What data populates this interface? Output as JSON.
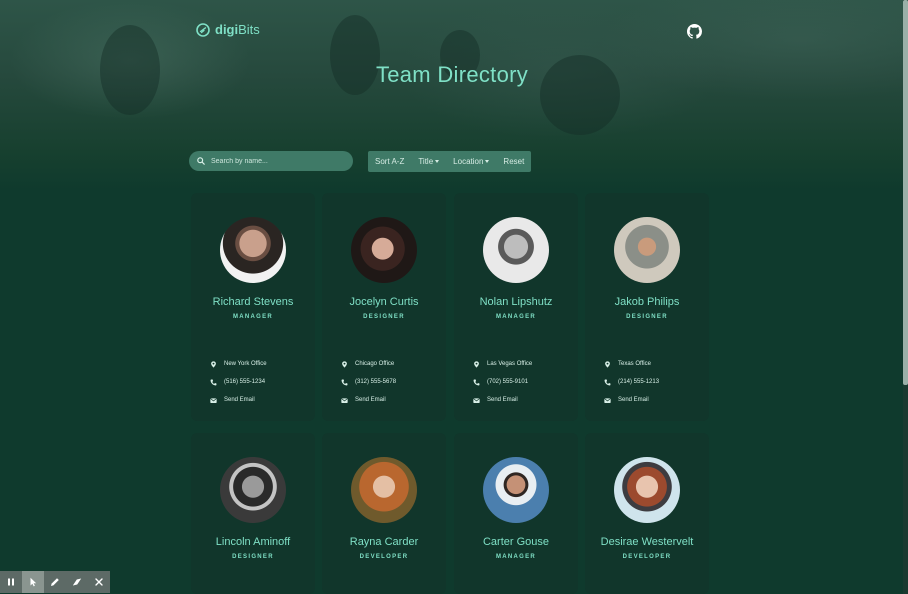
{
  "brand": {
    "prefix": "digi",
    "name": "Bits"
  },
  "page_title": "Team Directory",
  "search": {
    "placeholder": "Search by name..."
  },
  "toolbar": {
    "sort": "Sort A-Z",
    "title": "Title",
    "location": "Location",
    "reset": "Reset"
  },
  "people": [
    {
      "name": "Richard Stevens",
      "title": "MANAGER",
      "office": "New York Office",
      "phone": "(516) 555-1234",
      "email": "Send Email"
    },
    {
      "name": "Jocelyn Curtis",
      "title": "DESIGNER",
      "office": "Chicago Office",
      "phone": "(312) 555-5678",
      "email": "Send Email"
    },
    {
      "name": "Nolan Lipshutz",
      "title": "MANAGER",
      "office": "Las Vegas Office",
      "phone": "(702) 555-9101",
      "email": "Send Email"
    },
    {
      "name": "Jakob Philips",
      "title": "DESIGNER",
      "office": "Texas Office",
      "phone": "(214) 555-1213",
      "email": "Send Email"
    },
    {
      "name": "Lincoln Aminoff",
      "title": "DESIGNER"
    },
    {
      "name": "Rayna Carder",
      "title": "DEVELOPER"
    },
    {
      "name": "Carter Gouse",
      "title": "MANAGER"
    },
    {
      "name": "Desirae Westervelt",
      "title": "DEVELOPER"
    }
  ],
  "colors": {
    "accent": "#7fe0c6",
    "background": "#0f3a2d",
    "card": "#11362b",
    "control": "#3f7a67"
  },
  "icons": [
    "digibits-logo-icon",
    "github-icon",
    "search-icon",
    "location-pin-icon",
    "phone-icon",
    "envelope-icon",
    "pause-icon",
    "pointer-icon",
    "pencil-icon",
    "eraser-icon",
    "close-icon"
  ]
}
